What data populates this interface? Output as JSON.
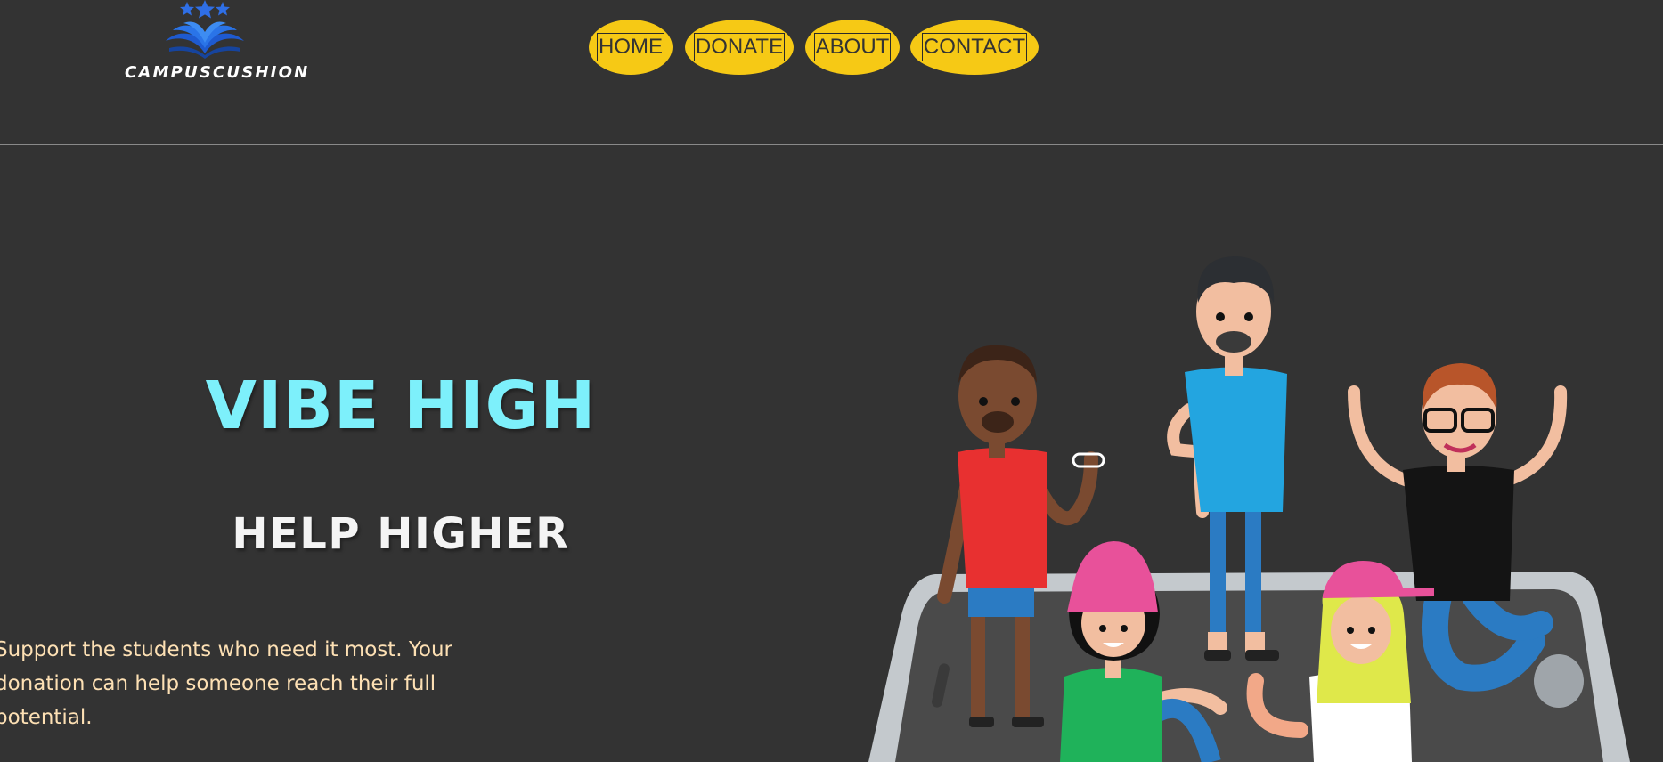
{
  "header": {
    "logo_text": "CAMPUSCUSHION"
  },
  "nav": {
    "items": [
      {
        "label": "HOME"
      },
      {
        "label": "DONATE"
      },
      {
        "label": "ABOUT"
      },
      {
        "label": "CONTACT"
      }
    ]
  },
  "hero": {
    "title": "VIBE HIGH",
    "subtitle": "HELP HIGHER",
    "description": "Support the students who need it most. Your donation can help someone reach their full potential."
  },
  "colors": {
    "background": "#333333",
    "accent_nav": "#f6c915",
    "title": "#7df0fb",
    "description": "#fde0b4",
    "logo_blue": "#1f5fd6"
  },
  "icons": {
    "logo": "book-with-stars-icon",
    "illustration": "students-on-phone-illustration"
  }
}
